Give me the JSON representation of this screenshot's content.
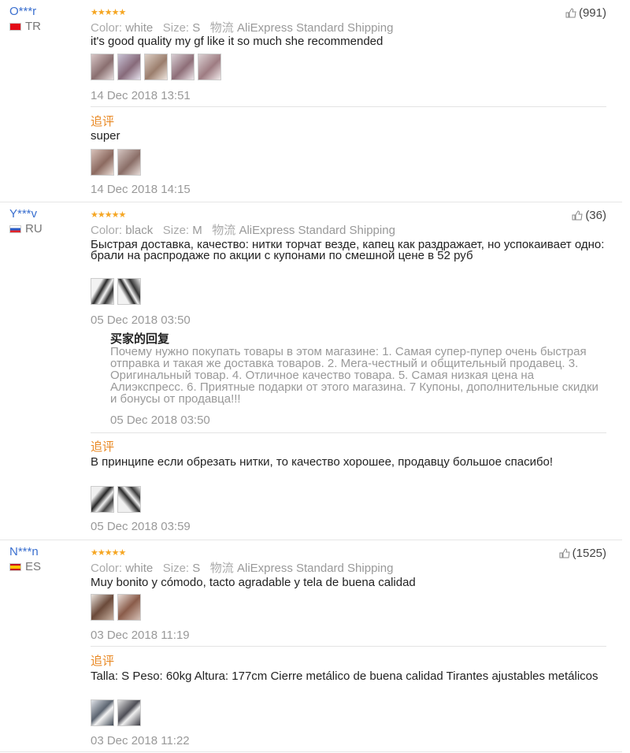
{
  "reviews": [
    {
      "user": "O***r",
      "country": "TR",
      "stars": "★★★★★",
      "likes": "(991)",
      "color_label": "Color:",
      "color": "white",
      "size_label": "Size:",
      "size": "S",
      "ship_label": "物流",
      "shipping": "AliExpress Standard Shipping",
      "text": "it's good quality my gf like it so much she recommended",
      "date": "14 Dec 2018 13:51",
      "followup_label": "追评",
      "followup_text": "super",
      "followup_date": "14 Dec 2018 14:15"
    },
    {
      "user": "Y***v",
      "country": "RU",
      "stars": "★★★★★",
      "likes": "(36)",
      "color_label": "Color:",
      "color": "black",
      "size_label": "Size:",
      "size": "M",
      "ship_label": "物流",
      "shipping": "AliExpress Standard Shipping",
      "text": "Быстрая доставка, качество: нитки торчат везде, капец как раздражает, но успокаивает одно: брали на распродаже по акции с купонами по смешной цене в 52 руб",
      "date": "05 Dec 2018 03:50",
      "reply_title": "买家的回复",
      "reply_text": "Почему нужно покупать товары в этом магазине: 1. Самая супер-пупер очень быстрая отправка и такая же доставка товаров. 2. Мега-честный и общительный продавец. 3. Оригинальный товар. 4. Отличное качество товара. 5. Самая низкая цена на Алиэкспресс. 6. Приятные подарки от этого магазина. 7 Купоны, дополнительные скидки и бонусы от продавца!!!",
      "reply_date": "05 Dec 2018 03:50",
      "followup_label": "追评",
      "followup_text": "В принципе если обрезать нитки, то качество хорошее, продавцу большое спасибо!",
      "followup_date": "05 Dec 2018 03:59"
    },
    {
      "user": "N***n",
      "country": "ES",
      "stars": "★★★★★",
      "likes": "(1525)",
      "color_label": "Color:",
      "color": "white",
      "size_label": "Size:",
      "size": "S",
      "ship_label": "物流",
      "shipping": "AliExpress Standard Shipping",
      "text": "Muy bonito y cómodo, tacto agradable y tela de buena calidad",
      "date": "03 Dec 2018 11:19",
      "followup_label": "追评",
      "followup_text": "Talla: S Peso: 60kg Altura: 177cm Cierre metálico de buena calidad Tirantes ajustables metálicos",
      "followup_date": "03 Dec 2018 11:22"
    }
  ]
}
